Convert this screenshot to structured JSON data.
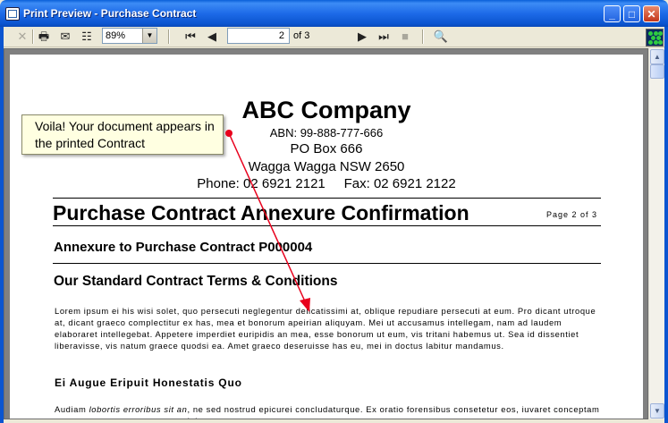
{
  "window": {
    "title": "Print Preview - Purchase Contract"
  },
  "toolbar": {
    "zoom": "89%",
    "current_page": "2",
    "page_of": "of 3"
  },
  "document": {
    "company_name": "ABC Company",
    "abn": "ABN: 99-888-777-666",
    "po_box": "PO Box 666",
    "city": "Wagga Wagga NSW 2650",
    "contact": "Phone: 02 6921 2121     Fax: 02 6921 2122",
    "title": "Purchase Contract Annexure Confirmation",
    "page_label": "Page 2 of 3",
    "annexure": "Annexure to Purchase Contract P000004",
    "terms_heading": "Our Standard Contract Terms & Conditions",
    "paragraph1": "Lorem ipsum ei his wisi solet, quo persecuti neglegentur delicatissimi at, oblique repudiare persecuti at eum. Pro dicant utroque at, dicant graeco complectitur ex has, mea et bonorum apeirian aliquyam. Mei ut accusamus intellegam, nam ad laudem elaboraret intellegebat. Appetere imperdiet euripidis an mea, esse bonorum ut eum, vis tritani habemus ut. Sea id dissentiet liberavisse, vis natum graece quodsi ea. Amet graeco deseruisse has eu, mei in doctus labitur mandamus.",
    "subheading": "Ei Augue Eripuit Honestatis Quo",
    "paragraph2_start": "Audiam ",
    "paragraph2_italic": "lobortis erroribus sit an",
    "paragraph2_rest": ", ne sed nostrud epicurei concludaturque. Ex oratio forensibus consetetur eos, iuvaret conceptam nam eu, est ea eros errem percipitur."
  },
  "callout": {
    "text": "Voila! Your document appears in the printed Contract"
  },
  "colors": {
    "titlebar": "#0a5fd8",
    "callout_bg": "#ffffe1",
    "arrow": "#e8001c"
  }
}
